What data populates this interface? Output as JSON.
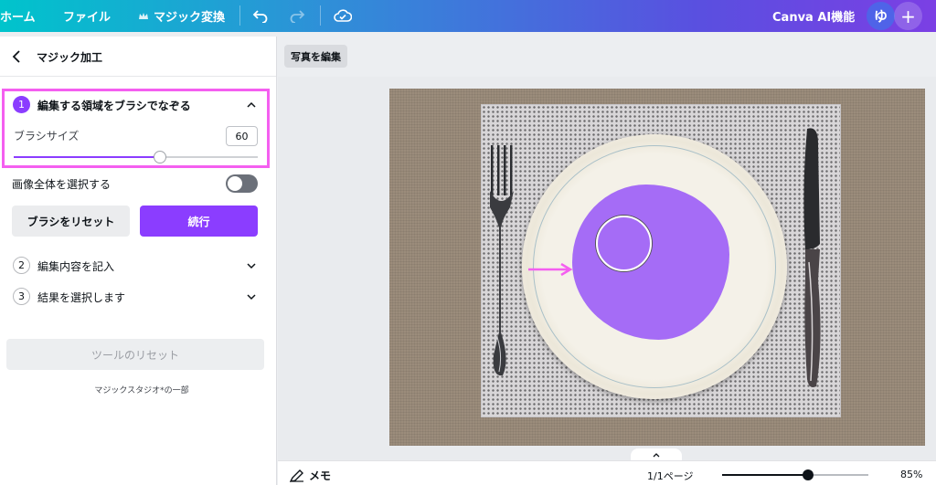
{
  "topbar": {
    "home": "ホーム",
    "file": "ファイル",
    "magic_switch": "マジック変換",
    "ai_features": "Canva AI機能",
    "avatar": "ゆ",
    "plus": "+"
  },
  "panel": {
    "title": "マジック加工",
    "step1": {
      "num": "1",
      "label": "編集する領域をブラシでなぞる"
    },
    "brush_size_label": "ブラシサイズ",
    "brush_size_value": "60",
    "brush_size_fraction": 0.6,
    "select_all_label": "画像全体を選択する",
    "select_all_on": false,
    "reset_brush": "ブラシをリセット",
    "continue": "続行",
    "step2": {
      "num": "2",
      "label": "編集内容を記入"
    },
    "step3": {
      "num": "3",
      "label": "結果を選択します"
    },
    "tool_reset": "ツールのリセット",
    "footer_note": "マジックスタジオ*の一部"
  },
  "canvas": {
    "edit_photo": "写真を編集"
  },
  "bottombar": {
    "memo": "メモ",
    "page_count": "1/1ページ",
    "zoom": "85%",
    "zoom_fraction": 0.59
  },
  "colors": {
    "accent": "#8b3dff",
    "highlight": "#f45ff0",
    "mask": "#a56cf6"
  }
}
